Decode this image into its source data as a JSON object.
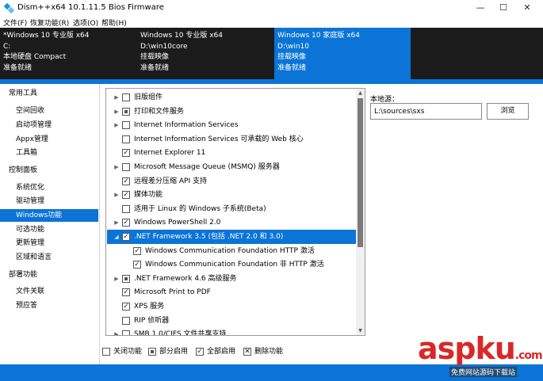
{
  "window": {
    "title": "Dism++x64 10.1.11.5 Bios Firmware",
    "minimize_glyph": "—",
    "maximize_glyph": "☐",
    "close_glyph": "✕"
  },
  "menu": [
    "文件(F)",
    "恢复功能(R)",
    "选项(O)",
    "帮助(H)"
  ],
  "os_images": [
    {
      "name": "*Windows 10 专业版 x64",
      "path": "C:",
      "type": "本地硬盘 Compact",
      "status": "准备就绪",
      "active": false
    },
    {
      "name": "Windows 10 专业版 x64",
      "path": "D:\\win10core",
      "type": "挂载映像",
      "status": "准备就绪",
      "active": false
    },
    {
      "name": "Windows 10 家庭版 x64",
      "path": "D:\\win10",
      "type": "挂载映像",
      "status": "准备就绪",
      "active": true
    }
  ],
  "sidebar": [
    {
      "label": "常用工具",
      "cat": true
    },
    {
      "label": "空间回收",
      "cat": false
    },
    {
      "label": "启动项管理",
      "cat": false
    },
    {
      "label": "Appx管理",
      "cat": false
    },
    {
      "label": "工具箱",
      "cat": false
    },
    {
      "label": "控制面板",
      "cat": true
    },
    {
      "label": "系统优化",
      "cat": false
    },
    {
      "label": "驱动管理",
      "cat": false
    },
    {
      "label": "Windows功能",
      "cat": false,
      "active": true
    },
    {
      "label": "可选功能",
      "cat": false
    },
    {
      "label": "更新管理",
      "cat": false
    },
    {
      "label": "区域和语言",
      "cat": false
    },
    {
      "label": "部署功能",
      "cat": true
    },
    {
      "label": "文件关联",
      "cat": false
    },
    {
      "label": "预应答",
      "cat": false
    }
  ],
  "features": [
    {
      "label": "旧版组件",
      "state": "unchecked",
      "expandable": true,
      "level": 0
    },
    {
      "label": "打印和文件服务",
      "state": "partial",
      "expandable": true,
      "level": 0
    },
    {
      "label": "Internet Information Services",
      "state": "unchecked",
      "expandable": true,
      "level": 0
    },
    {
      "label": "Internet Information Services 可承载的 Web 核心",
      "state": "unchecked",
      "expandable": false,
      "level": 0
    },
    {
      "label": "Internet Explorer 11",
      "state": "checked",
      "expandable": false,
      "level": 0
    },
    {
      "label": "Microsoft Message Queue (MSMQ) 服务器",
      "state": "unchecked",
      "expandable": true,
      "level": 0
    },
    {
      "label": "远程差分压缩 API 支持",
      "state": "checked",
      "expandable": false,
      "level": 0
    },
    {
      "label": "媒体功能",
      "state": "checked",
      "expandable": true,
      "level": 0
    },
    {
      "label": "适用于 Linux 的 Windows 子系统(Beta)",
      "state": "unchecked",
      "expandable": false,
      "level": 0
    },
    {
      "label": "Windows PowerShell 2.0",
      "state": "checked",
      "expandable": true,
      "level": 0
    },
    {
      "label": ".NET Framework 3.5 (包括 .NET 2.0 和 3.0)",
      "state": "checked",
      "expandable": true,
      "expanded": true,
      "level": 0,
      "selected": true
    },
    {
      "label": "Windows Communication Foundation HTTP 激活",
      "state": "checked",
      "expandable": false,
      "level": 1
    },
    {
      "label": "Windows Communication Foundation 非 HTTP 激活",
      "state": "checked",
      "expandable": false,
      "level": 1
    },
    {
      "label": ".NET Framework 4.6 高级服务",
      "state": "partial",
      "expandable": true,
      "level": 0
    },
    {
      "label": "Microsoft Print to PDF",
      "state": "checked",
      "expandable": false,
      "level": 0
    },
    {
      "label": "XPS 服务",
      "state": "checked",
      "expandable": false,
      "level": 0
    },
    {
      "label": "RIP 侦听器",
      "state": "unchecked",
      "expandable": false,
      "level": 0
    },
    {
      "label": "SMB 1.0/CIFS 文件共享支持",
      "state": "unchecked",
      "expandable": true,
      "level": 0
    }
  ],
  "source": {
    "label": "本地源：",
    "value": "L:\\sources\\sxs",
    "browse_label": "浏览"
  },
  "legend": [
    {
      "label": "关闭功能",
      "state": "unchecked"
    },
    {
      "label": "部分启用",
      "state": "partial"
    },
    {
      "label": "全部启用",
      "state": "checked"
    },
    {
      "label": "删除功能",
      "state": "removed"
    }
  ],
  "watermark": {
    "main": "aspku",
    "domain": ".com",
    "sub": "免费网站源码下载站"
  },
  "colors": {
    "accent": "#0b74d6",
    "dark_bar": "#1b1b1b",
    "watermark": "#d82828"
  }
}
